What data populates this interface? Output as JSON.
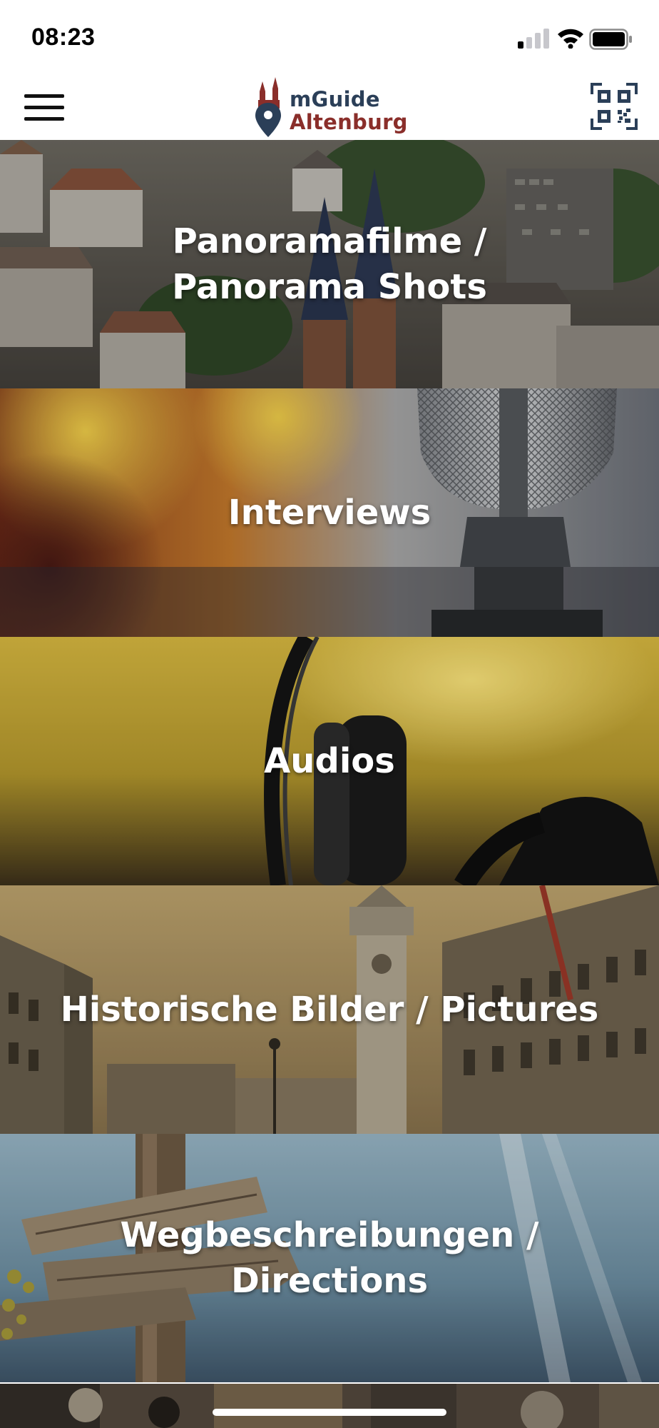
{
  "status_bar": {
    "time": "08:23",
    "icons": [
      "cellular-signal-icon",
      "wifi-icon",
      "battery-icon"
    ]
  },
  "header": {
    "logo_line1": "mGuide",
    "logo_line2": "Altenburg",
    "menu_icon": "hamburger-menu-icon",
    "qr_icon": "qr-code-icon"
  },
  "tiles": [
    {
      "label_line1": "Panoramafilme /",
      "label_line2": "Panorama Shots"
    },
    {
      "label_line1": "Interviews",
      "label_line2": ""
    },
    {
      "label_line1": "Audios",
      "label_line2": ""
    },
    {
      "label_line1": "Historische Bilder / Pictures",
      "label_line2": ""
    },
    {
      "label_line1": "Wegbeschreibungen /",
      "label_line2": "Directions"
    }
  ],
  "colors": {
    "logo_blue": "#2b3f58",
    "logo_red": "#8a2e2a",
    "tile_text": "#ffffff"
  }
}
